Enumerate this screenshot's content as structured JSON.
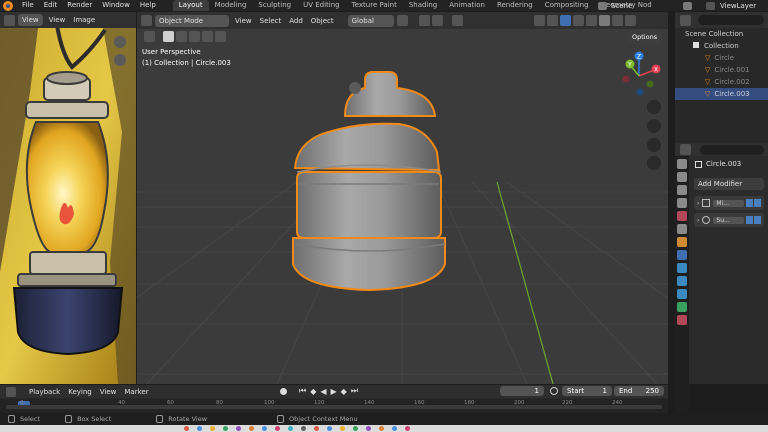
{
  "topbar": {
    "menus": [
      "File",
      "Edit",
      "Render",
      "Window",
      "Help"
    ],
    "workspaces": [
      "Layout",
      "Modeling",
      "Sculpting",
      "UV Editing",
      "Texture Paint",
      "Shading",
      "Animation",
      "Rendering",
      "Compositing",
      "Geometry Nod"
    ],
    "active_workspace": "Layout",
    "scene": "Scene",
    "view_layer": "ViewLayer"
  },
  "image_editor": {
    "view_label": "View",
    "menus": [
      "View",
      "Image"
    ]
  },
  "viewport": {
    "mode": "Object Mode",
    "menus": [
      "View",
      "Select",
      "Add",
      "Object"
    ],
    "orientation": "Global",
    "options_label": "Options",
    "overlay_line1": "User Perspective",
    "overlay_line2": "(1) Collection | Circle.003",
    "gizmo": {
      "x": "X",
      "y": "Y",
      "z": "Z"
    }
  },
  "outliner": {
    "scene_collection": "Scene Collection",
    "collection": "Collection",
    "items": [
      "Circle",
      "Circle.001",
      "Circle.002",
      "Circle.003"
    ],
    "selected_index": 3
  },
  "properties": {
    "object_name": "Circle.003",
    "add_modifier": "Add Modifier",
    "modifiers": [
      "Mi...",
      "Su..."
    ]
  },
  "timeline": {
    "playback": "Playback",
    "keying": "Keying",
    "view": "View",
    "marker": "Marker",
    "current_frame": "1",
    "start_label": "Start",
    "start": "1",
    "end_label": "End",
    "end": "250",
    "ruler": [
      "0",
      "40",
      "60",
      "80",
      "100",
      "120",
      "140",
      "160",
      "180",
      "200",
      "220",
      "240"
    ]
  },
  "statusbar": {
    "items": [
      "Select",
      "Box Select",
      "Rotate View",
      "Object Context Menu"
    ]
  },
  "colors": {
    "accent": "#f08a1c",
    "selection": "#334d80",
    "axis_x": "#e0404f",
    "axis_y": "#7bbd2e",
    "axis_z": "#2f7fe0"
  }
}
